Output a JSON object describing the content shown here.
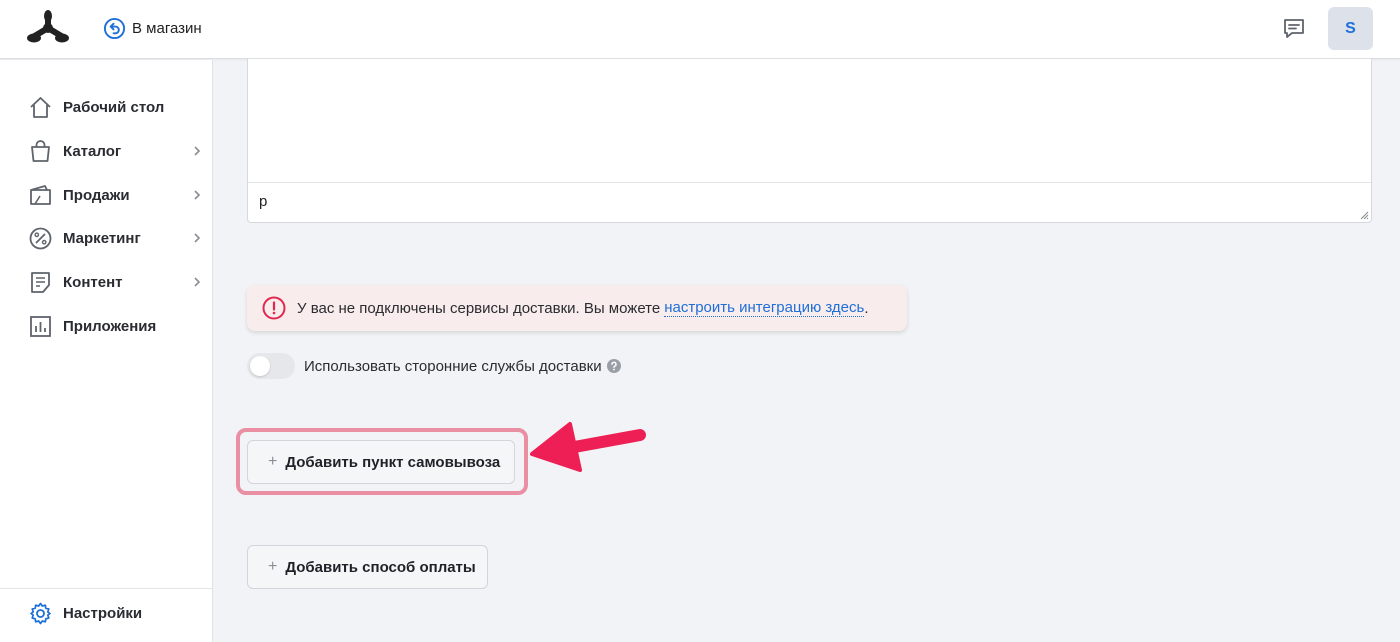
{
  "header": {
    "store_link_label": "В магазин",
    "avatar_initial": "S"
  },
  "sidebar": {
    "items": [
      {
        "label": "Рабочий стол",
        "icon": "home-icon",
        "has_chevron": false
      },
      {
        "label": "Каталог",
        "icon": "shopping-bag-icon",
        "has_chevron": true
      },
      {
        "label": "Продажи",
        "icon": "sales-icon",
        "has_chevron": true
      },
      {
        "label": "Маркетинг",
        "icon": "percent-icon",
        "has_chevron": true
      },
      {
        "label": "Контент",
        "icon": "content-icon",
        "has_chevron": true
      },
      {
        "label": "Приложения",
        "icon": "apps-chart-icon",
        "has_chevron": false
      }
    ],
    "settings_label": "Настройки"
  },
  "editor": {
    "path_text": "p"
  },
  "alert": {
    "text": "У вас не подключены сервисы доставки. Вы можете",
    "link_text": "настроить интеграцию здесь",
    "suffix": "."
  },
  "toggle": {
    "label": "Использовать сторонние службы доставки",
    "enabled": false
  },
  "buttons": {
    "plus_symbol": "+",
    "add_pickup_label": "Добавить пункт самовывоза",
    "add_payment_label": "Добавить способ оплаты"
  },
  "colors": {
    "accent": "#1e6fd8",
    "alert_bg": "#f8ecec",
    "alert_icon": "#e0284e",
    "highlight": "#ea8ea4",
    "arrow": "#ee1f55"
  }
}
